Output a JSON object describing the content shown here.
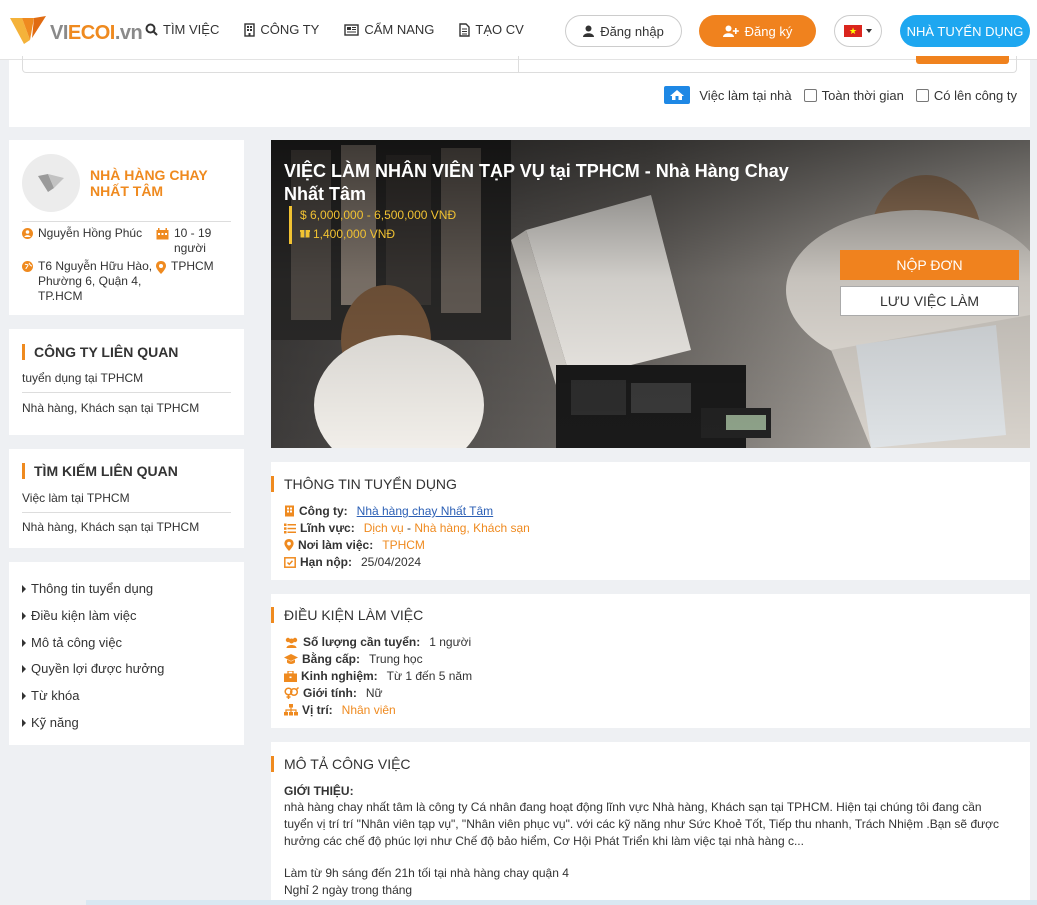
{
  "header": {
    "logo_text_left": "VI",
    "logo_text_accent": "ECOI",
    "logo_text_right": ".vn",
    "nav": [
      {
        "label": "TÌM VIỆC",
        "icon": "search-icon"
      },
      {
        "label": "CÔNG TY",
        "icon": "building-icon"
      },
      {
        "label": "CẨM NANG",
        "icon": "newspaper-icon"
      },
      {
        "label": "TẠO CV",
        "icon": "document-icon"
      }
    ],
    "login_label": "Đăng nhập",
    "register_label": "Đăng ký",
    "employer_label": "NHÀ TUYỂN DỤNG",
    "colors": {
      "accent": "#f0821e",
      "blue": "#1ea7f0"
    }
  },
  "filters": {
    "remote_label": "Việc làm tại nhà",
    "fulltime_label": "Toàn thời gian",
    "onsite_label": "Có lên công ty"
  },
  "company": {
    "name": "NHÀ HÀNG CHAY NHẤT TÂM",
    "contact": "Nguyễn Hồng Phúc",
    "size": "10 - 19 người",
    "address": "T6 Nguyễn Hữu Hào, Phường 6, Quận 4, TP.HCM",
    "city": "TPHCM"
  },
  "related_companies": {
    "title": "CÔNG TY LIÊN QUAN",
    "links": [
      "tuyển dụng tại TPHCM",
      "Nhà hàng, Khách sạn tại TPHCM"
    ]
  },
  "related_search": {
    "title": "TÌM KIẾM LIÊN QUAN",
    "links": [
      "Việc làm tại TPHCM",
      "Nhà hàng, Khách sạn tại TPHCM"
    ]
  },
  "toc": [
    "Thông tin tuyển dụng",
    "Điều kiện làm việc",
    "Mô tả công việc",
    "Quyền lợi được hưởng",
    "Từ khóa",
    "Kỹ năng"
  ],
  "job": {
    "title": "VIỆC LÀM NHÂN VIÊN TẠP VỤ tại TPHCM - Nhà Hàng Chay Nhất Tâm",
    "salary": "6,000,000 - 6,500,000 VNĐ",
    "allowance": "1,400,000 VNĐ",
    "apply_label": "NỘP ĐƠN",
    "save_label": "LƯU VIỆC LÀM"
  },
  "recruit_info": {
    "title": "THÔNG TIN TUYỂN DỤNG",
    "company_k": "Công ty:",
    "company_v": "Nhà hàng chay Nhất Tâm",
    "field_k": "Lĩnh vực:",
    "field_v1": "Dịch vụ",
    "field_sep": " - ",
    "field_v2": "Nhà hàng, Khách sạn",
    "location_k": "Nơi làm việc:",
    "location_v": "TPHCM",
    "deadline_k": "Hạn nộp:",
    "deadline_v": "25/04/2024"
  },
  "conditions": {
    "title": "ĐIỀU KIỆN LÀM VIỆC",
    "qty_k": "Số lượng cần tuyển:",
    "qty_v": "1 người",
    "degree_k": "Bằng cấp:",
    "degree_v": "Trung học",
    "exp_k": "Kinh nghiệm:",
    "exp_v": "Từ 1 đến 5 năm",
    "gender_k": "Giới tính:",
    "gender_v": "Nữ",
    "position_k": "Vị trí:",
    "position_v": "Nhân viên"
  },
  "description": {
    "title": "MÔ TẢ CÔNG VIỆC",
    "intro_heading": "GIỚI THIỆU:",
    "intro_text": "nhà hàng chay nhất tâm là công ty Cá nhân đang hoạt động lĩnh vực Nhà hàng, Khách sạn tại TPHCM. Hiện tại chúng tôi đang cần tuyển vị trí trí \"Nhân viên tạp vụ\", \"Nhân viên phục vụ\". với các kỹ năng như Sức Khoẻ Tốt, Tiếp thu nhanh, Trách Nhiệm .Bạn sẽ được hưởng các chế độ phúc lợi như Chế độ bảo hiểm, Cơ Hội Phát Triển khi làm việc tại nhà hàng c...",
    "line1": "Làm từ 9h sáng đến 21h tối tại nhà hàng chay quận 4",
    "line2": "Nghỉ 2 ngày trong tháng"
  }
}
